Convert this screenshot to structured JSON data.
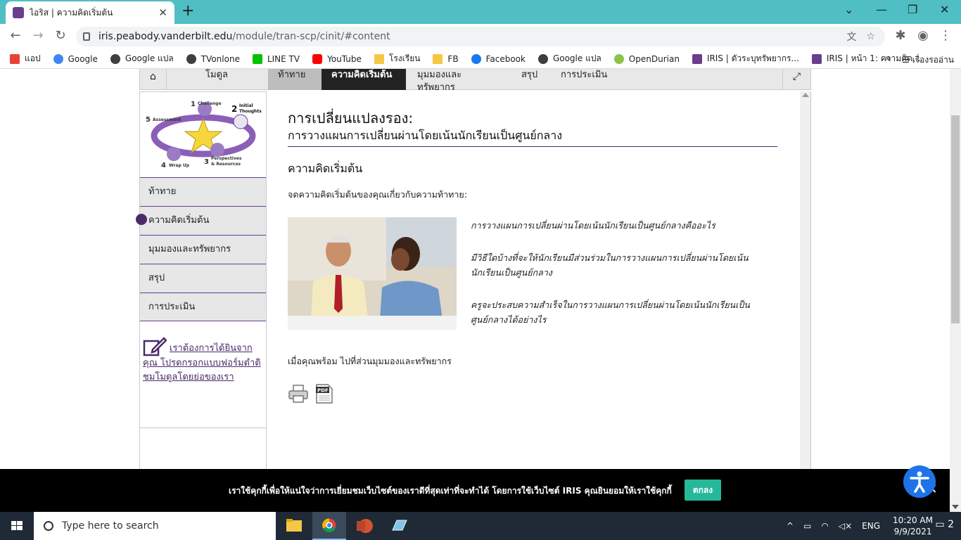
{
  "browser": {
    "tab_title": "ไอริส | ความคิดเริ่มต้น",
    "url_host": "iris.peabody.vanderbilt.edu",
    "url_path": "/module/tran-scp/cinit/#content",
    "bookmarks": [
      {
        "label": "แอป",
        "color": "#e94235"
      },
      {
        "label": "Google",
        "color": "#4285f4"
      },
      {
        "label": "Google แปล",
        "color": "#3c4043"
      },
      {
        "label": "TVonlone",
        "color": "#3c4043"
      },
      {
        "label": "LINE TV",
        "color": "#00c300"
      },
      {
        "label": "YouTube",
        "color": "#ff0000"
      },
      {
        "label": "โรงเรียน",
        "color": "#f6c744"
      },
      {
        "label": "FB",
        "color": "#f6c744"
      },
      {
        "label": "Facebook",
        "color": "#1877f2"
      },
      {
        "label": "Google แปล",
        "color": "#3c4043"
      },
      {
        "label": "OpenDurian",
        "color": "#8bc34a"
      },
      {
        "label": "IRIS | ตัวระบุทรัพยากร...",
        "color": "#6a3d8f"
      },
      {
        "label": "IRIS | หน้า 1: ความคิด...",
        "color": "#6a3d8f"
      }
    ],
    "more": "»",
    "reading_list": "เรื่องรออ่าน"
  },
  "module_nav": {
    "module_label": "โมดูล",
    "steps": [
      "ท้าทาย",
      "ความคิดเริ่มต้น",
      "มุมมองและทรัพยากร",
      "สรุป",
      "การประเมิน"
    ]
  },
  "cycle": {
    "n1": "1",
    "l1": "Challenge",
    "n2": "2",
    "l2a": "Initial",
    "l2b": "Thoughts",
    "n3": "3",
    "l3a": "Perspectives",
    "l3b": "& Resources",
    "n4": "4",
    "l4": "Wrap Up",
    "n5": "5",
    "l5": "Assessment"
  },
  "sidebar": {
    "items": [
      "ท้าทาย",
      "ความคิดเริ่มต้น",
      "มุมมองและทรัพยากร",
      "สรุป",
      "การประเมิน"
    ],
    "active_index": 1,
    "feedback": "เราต้องการได้ยินจากคุณ โปรดกรอกแบบฟอร์มตำติชมโมดูลโดยย่อของเรา"
  },
  "content": {
    "title": "การเปลี่ยนแปลงรอง:",
    "subtitle": "การวางแผนการเปลี่ยนผ่านโดยเน้นนักเรียนเป็นศูนย์กลาง",
    "heading": "ความคิดเริ่มต้น",
    "intro": "จดความคิดเริ่มต้นของคุณเกี่ยวกับความท้าทาย:",
    "questions": [
      "การวางแผนการเปลี่ยนผ่านโดยเน้นนักเรียนเป็นศูนย์กลางคืออะไร",
      "มีวิธีใดบ้างที่จะให้นักเรียนมีส่วนร่วมในการวางแผนการเปลี่ยนผ่านโดยเน้นนักเรียนเป็นศูนย์กลาง",
      "ครูจะประสบความสำเร็จในการวางแผนการเปลี่ยนผ่านโดยเน้นนักเรียนเป็นศูนย์กลางได้อย่างไร"
    ],
    "next": "เมื่อคุณพร้อม ไปที่ส่วนมุมมองและทรัพยากร",
    "pdf_label": "PDF"
  },
  "cookie": {
    "text": "เราใช้คุกกี้เพื่อให้แน่ใจว่าการเยี่ยมชมเว็บไซต์ของเราดีที่สุดเท่าที่จะทำได้ โดยการใช้เว็บไซต์ IRIS คุณยินยอมให้เราใช้คุกกี้",
    "button": "ตกลง"
  },
  "taskbar": {
    "search_placeholder": "Type here to search",
    "lang": "ENG",
    "time": "10:20 AM",
    "date": "9/9/2021",
    "notifications": "2"
  },
  "colors": {
    "accent_purple": "#4b2a6a",
    "chrome_tabbar": "#4fbfc3",
    "cookie_button": "#26b89a",
    "a11y_button": "#1e73e8"
  }
}
